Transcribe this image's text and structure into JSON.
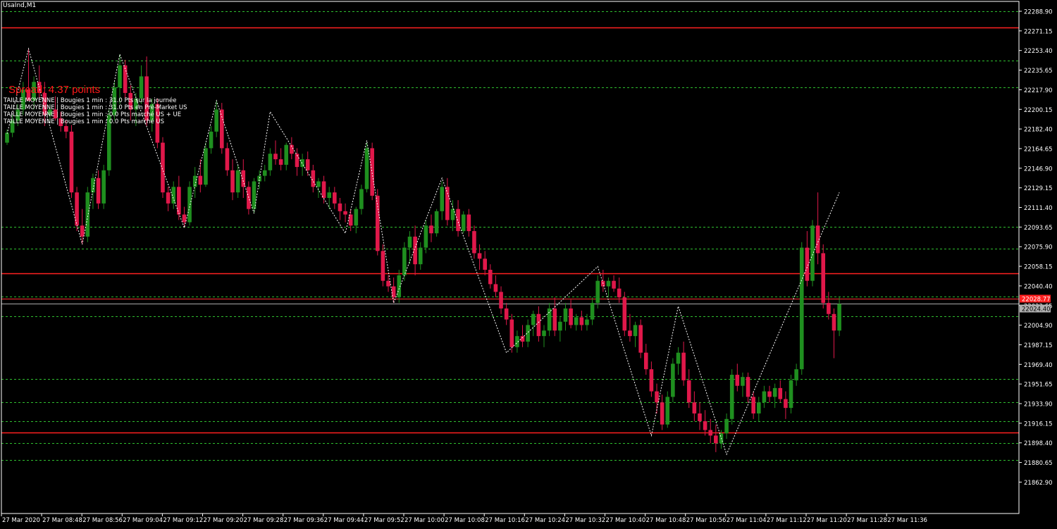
{
  "window": {
    "symbol_label": "UsaInd,M1"
  },
  "spread": {
    "label": "Spread: 4.37 points"
  },
  "info_lines": [
    "TAILLE MOYENNE | Bougies 1 min : 31.0 Pts sur la journée",
    "TAILLE MOYENNE | Bougies 1 min : 31.0 Pts en Pré-Market US",
    "TAILLE MOYENNE | Bougies 1 min : 0.0 Pts marché US + UE",
    "TAILLE MOYENNE | Bougies 1 min : 0.0 Pts marché US"
  ],
  "colors": {
    "background": "#000000",
    "bull": "#1f8f1f",
    "bear": "#e0184a",
    "grid_dashed": "#2fbf2f",
    "level_line": "#ff2020",
    "zigzag": "#ffffff",
    "axis_text": "#ffffff"
  },
  "price_axis": {
    "ticks": [
      "22288.90",
      "22271.15",
      "22253.40",
      "22235.65",
      "22217.90",
      "22200.15",
      "22182.40",
      "22164.65",
      "22146.90",
      "22129.15",
      "22111.40",
      "22093.65",
      "22075.90",
      "22058.15",
      "22040.40",
      "22022.65",
      "22004.90",
      "21987.15",
      "21969.40",
      "21951.65",
      "21933.90",
      "21916.15",
      "21898.40",
      "21880.65",
      "21862.90"
    ],
    "bid_label": "22024.40",
    "ask_label": "22028.77"
  },
  "time_axis": {
    "labels": [
      "27 Mar 2020",
      "27 Mar 08:48",
      "27 Mar 08:56",
      "27 Mar 09:04",
      "27 Mar 09:12",
      "27 Mar 09:20",
      "27 Mar 09:28",
      "27 Mar 09:36",
      "27 Mar 09:44",
      "27 Mar 09:52",
      "27 Mar 10:00",
      "27 Mar 10:08",
      "27 Mar 10:16",
      "27 Mar 10:24",
      "27 Mar 10:32",
      "27 Mar 10:40",
      "27 Mar 10:48",
      "27 Mar 10:56",
      "27 Mar 11:04",
      "27 Mar 11:12",
      "27 Mar 11:20",
      "27 Mar 11:28",
      "27 Mar 11:36"
    ]
  },
  "levels": {
    "solid_red": [
      22274,
      22052,
      21908
    ],
    "dashed_green": [
      22288.9,
      22244,
      22220,
      22094,
      22074,
      22031,
      22013,
      21956,
      21935,
      21918,
      21898,
      21883
    ]
  },
  "chart_data": {
    "type": "candlestick",
    "interval": "M1",
    "price_range": [
      21855,
      22297
    ],
    "candles": [
      {
        "o": 22170,
        "h": 22182,
        "l": 22168,
        "c": 22179
      },
      {
        "o": 22179,
        "h": 22195,
        "l": 22175,
        "c": 22190
      },
      {
        "o": 22190,
        "h": 22205,
        "l": 22185,
        "c": 22200
      },
      {
        "o": 22200,
        "h": 22225,
        "l": 22195,
        "c": 22218
      },
      {
        "o": 22218,
        "h": 22255,
        "l": 22212,
        "c": 22208
      },
      {
        "o": 22208,
        "h": 22230,
        "l": 22200,
        "c": 22225
      },
      {
        "o": 22225,
        "h": 22240,
        "l": 22210,
        "c": 22215
      },
      {
        "o": 22215,
        "h": 22225,
        "l": 22185,
        "c": 22195
      },
      {
        "o": 22195,
        "h": 22205,
        "l": 22188,
        "c": 22200
      },
      {
        "o": 22200,
        "h": 22212,
        "l": 22190,
        "c": 22192
      },
      {
        "o": 22192,
        "h": 22198,
        "l": 22180,
        "c": 22185
      },
      {
        "o": 22185,
        "h": 22190,
        "l": 22174,
        "c": 22180
      },
      {
        "o": 22180,
        "h": 22186,
        "l": 22120,
        "c": 22125
      },
      {
        "o": 22125,
        "h": 22130,
        "l": 22090,
        "c": 22095
      },
      {
        "o": 22095,
        "h": 22110,
        "l": 22078,
        "c": 22085
      },
      {
        "o": 22085,
        "h": 22130,
        "l": 22080,
        "c": 22125
      },
      {
        "o": 22125,
        "h": 22142,
        "l": 22110,
        "c": 22138
      },
      {
        "o": 22138,
        "h": 22145,
        "l": 22110,
        "c": 22115
      },
      {
        "o": 22115,
        "h": 22150,
        "l": 22110,
        "c": 22145
      },
      {
        "o": 22145,
        "h": 22200,
        "l": 22140,
        "c": 22195
      },
      {
        "o": 22195,
        "h": 22225,
        "l": 22190,
        "c": 22220
      },
      {
        "o": 22220,
        "h": 22250,
        "l": 22205,
        "c": 22240
      },
      {
        "o": 22240,
        "h": 22245,
        "l": 22210,
        "c": 22215
      },
      {
        "o": 22215,
        "h": 22222,
        "l": 22190,
        "c": 22200
      },
      {
        "o": 22200,
        "h": 22215,
        "l": 22185,
        "c": 22210
      },
      {
        "o": 22210,
        "h": 22240,
        "l": 22205,
        "c": 22230
      },
      {
        "o": 22230,
        "h": 22248,
        "l": 22185,
        "c": 22190
      },
      {
        "o": 22190,
        "h": 22210,
        "l": 22180,
        "c": 22205
      },
      {
        "o": 22205,
        "h": 22210,
        "l": 22165,
        "c": 22170
      },
      {
        "o": 22170,
        "h": 22175,
        "l": 22120,
        "c": 22125
      },
      {
        "o": 22125,
        "h": 22130,
        "l": 22108,
        "c": 22115
      },
      {
        "o": 22115,
        "h": 22135,
        "l": 22110,
        "c": 22130
      },
      {
        "o": 22130,
        "h": 22140,
        "l": 22100,
        "c": 22105
      },
      {
        "o": 22105,
        "h": 22112,
        "l": 22093,
        "c": 22098
      },
      {
        "o": 22098,
        "h": 22135,
        "l": 22095,
        "c": 22130
      },
      {
        "o": 22130,
        "h": 22148,
        "l": 22120,
        "c": 22140
      },
      {
        "o": 22140,
        "h": 22155,
        "l": 22125,
        "c": 22132
      },
      {
        "o": 22132,
        "h": 22170,
        "l": 22130,
        "c": 22165
      },
      {
        "o": 22165,
        "h": 22185,
        "l": 22160,
        "c": 22180
      },
      {
        "o": 22180,
        "h": 22208,
        "l": 22175,
        "c": 22200
      },
      {
        "o": 22200,
        "h": 22206,
        "l": 22160,
        "c": 22165
      },
      {
        "o": 22165,
        "h": 22170,
        "l": 22140,
        "c": 22145
      },
      {
        "o": 22145,
        "h": 22155,
        "l": 22118,
        "c": 22125
      },
      {
        "o": 22125,
        "h": 22150,
        "l": 22120,
        "c": 22145
      },
      {
        "o": 22145,
        "h": 22155,
        "l": 22120,
        "c": 22130
      },
      {
        "o": 22130,
        "h": 22135,
        "l": 22105,
        "c": 22110
      },
      {
        "o": 22110,
        "h": 22138,
        "l": 22106,
        "c": 22135
      },
      {
        "o": 22135,
        "h": 22145,
        "l": 22128,
        "c": 22140
      },
      {
        "o": 22140,
        "h": 22150,
        "l": 22135,
        "c": 22145
      },
      {
        "o": 22145,
        "h": 22165,
        "l": 22140,
        "c": 22160
      },
      {
        "o": 22160,
        "h": 22172,
        "l": 22150,
        "c": 22155
      },
      {
        "o": 22155,
        "h": 22165,
        "l": 22145,
        "c": 22150
      },
      {
        "o": 22150,
        "h": 22170,
        "l": 22145,
        "c": 22168
      },
      {
        "o": 22168,
        "h": 22175,
        "l": 22155,
        "c": 22160
      },
      {
        "o": 22160,
        "h": 22165,
        "l": 22140,
        "c": 22148
      },
      {
        "o": 22148,
        "h": 22160,
        "l": 22140,
        "c": 22155
      },
      {
        "o": 22155,
        "h": 22162,
        "l": 22140,
        "c": 22145
      },
      {
        "o": 22145,
        "h": 22150,
        "l": 22125,
        "c": 22130
      },
      {
        "o": 22130,
        "h": 22138,
        "l": 22120,
        "c": 22135
      },
      {
        "o": 22135,
        "h": 22140,
        "l": 22115,
        "c": 22120
      },
      {
        "o": 22120,
        "h": 22130,
        "l": 22110,
        "c": 22125
      },
      {
        "o": 22125,
        "h": 22130,
        "l": 22110,
        "c": 22115
      },
      {
        "o": 22115,
        "h": 22120,
        "l": 22100,
        "c": 22108
      },
      {
        "o": 22108,
        "h": 22115,
        "l": 22098,
        "c": 22105
      },
      {
        "o": 22105,
        "h": 22110,
        "l": 22090,
        "c": 22095
      },
      {
        "o": 22095,
        "h": 22112,
        "l": 22088,
        "c": 22110
      },
      {
        "o": 22110,
        "h": 22132,
        "l": 22105,
        "c": 22128
      },
      {
        "o": 22128,
        "h": 22170,
        "l": 22125,
        "c": 22165
      },
      {
        "o": 22165,
        "h": 22170,
        "l": 22118,
        "c": 22122
      },
      {
        "o": 22122,
        "h": 22128,
        "l": 22068,
        "c": 22072
      },
      {
        "o": 22072,
        "h": 22078,
        "l": 22040,
        "c": 22045
      },
      {
        "o": 22045,
        "h": 22050,
        "l": 22035,
        "c": 22040
      },
      {
        "o": 22040,
        "h": 22048,
        "l": 22025,
        "c": 22030
      },
      {
        "o": 22030,
        "h": 22055,
        "l": 22025,
        "c": 22050
      },
      {
        "o": 22050,
        "h": 22080,
        "l": 22045,
        "c": 22075
      },
      {
        "o": 22075,
        "h": 22090,
        "l": 22060,
        "c": 22085
      },
      {
        "o": 22085,
        "h": 22095,
        "l": 22050,
        "c": 22060
      },
      {
        "o": 22060,
        "h": 22080,
        "l": 22055,
        "c": 22075
      },
      {
        "o": 22075,
        "h": 22100,
        "l": 22070,
        "c": 22095
      },
      {
        "o": 22095,
        "h": 22105,
        "l": 22080,
        "c": 22088
      },
      {
        "o": 22088,
        "h": 22110,
        "l": 22085,
        "c": 22108
      },
      {
        "o": 22108,
        "h": 22135,
        "l": 22100,
        "c": 22130
      },
      {
        "o": 22130,
        "h": 22138,
        "l": 22095,
        "c": 22100
      },
      {
        "o": 22100,
        "h": 22118,
        "l": 22090,
        "c": 22110
      },
      {
        "o": 22110,
        "h": 22118,
        "l": 22085,
        "c": 22090
      },
      {
        "o": 22090,
        "h": 22108,
        "l": 22088,
        "c": 22105
      },
      {
        "o": 22105,
        "h": 22110,
        "l": 22085,
        "c": 22090
      },
      {
        "o": 22090,
        "h": 22095,
        "l": 22065,
        "c": 22070
      },
      {
        "o": 22070,
        "h": 22078,
        "l": 22055,
        "c": 22065
      },
      {
        "o": 22065,
        "h": 22072,
        "l": 22050,
        "c": 22055
      },
      {
        "o": 22055,
        "h": 22060,
        "l": 22038,
        "c": 22042
      },
      {
        "o": 22042,
        "h": 22050,
        "l": 22030,
        "c": 22035
      },
      {
        "o": 22035,
        "h": 22040,
        "l": 22015,
        "c": 22020
      },
      {
        "o": 22020,
        "h": 22025,
        "l": 22005,
        "c": 22010
      },
      {
        "o": 22010,
        "h": 22015,
        "l": 21980,
        "c": 21985
      },
      {
        "o": 21985,
        "h": 22000,
        "l": 21980,
        "c": 21995
      },
      {
        "o": 21995,
        "h": 22005,
        "l": 21985,
        "c": 21990
      },
      {
        "o": 21990,
        "h": 22010,
        "l": 21985,
        "c": 22005
      },
      {
        "o": 22005,
        "h": 22018,
        "l": 21995,
        "c": 22015
      },
      {
        "o": 22015,
        "h": 22022,
        "l": 21990,
        "c": 21995
      },
      {
        "o": 21995,
        "h": 22005,
        "l": 21985,
        "c": 22000
      },
      {
        "o": 22000,
        "h": 22025,
        "l": 21995,
        "c": 22020
      },
      {
        "o": 22020,
        "h": 22030,
        "l": 21995,
        "c": 22000
      },
      {
        "o": 22000,
        "h": 22012,
        "l": 21990,
        "c": 22008
      },
      {
        "o": 22008,
        "h": 22025,
        "l": 22000,
        "c": 22020
      },
      {
        "o": 22020,
        "h": 22028,
        "l": 22002,
        "c": 22005
      },
      {
        "o": 22005,
        "h": 22015,
        "l": 22000,
        "c": 22012
      },
      {
        "o": 22012,
        "h": 22018,
        "l": 22000,
        "c": 22005
      },
      {
        "o": 22005,
        "h": 22015,
        "l": 22000,
        "c": 22010
      },
      {
        "o": 22010,
        "h": 22030,
        "l": 22005,
        "c": 22025
      },
      {
        "o": 22025,
        "h": 22050,
        "l": 22020,
        "c": 22045
      },
      {
        "o": 22045,
        "h": 22055,
        "l": 22035,
        "c": 22040
      },
      {
        "o": 22040,
        "h": 22048,
        "l": 22030,
        "c": 22045
      },
      {
        "o": 22045,
        "h": 22050,
        "l": 22035,
        "c": 22038
      },
      {
        "o": 22038,
        "h": 22048,
        "l": 22025,
        "c": 22030
      },
      {
        "o": 22030,
        "h": 22035,
        "l": 21995,
        "c": 22000
      },
      {
        "o": 22000,
        "h": 22015,
        "l": 21990,
        "c": 21995
      },
      {
        "o": 21995,
        "h": 22008,
        "l": 21985,
        "c": 22005
      },
      {
        "o": 22005,
        "h": 22010,
        "l": 21975,
        "c": 21980
      },
      {
        "o": 21980,
        "h": 21988,
        "l": 21960,
        "c": 21965
      },
      {
        "o": 21965,
        "h": 21972,
        "l": 21940,
        "c": 21945
      },
      {
        "o": 21945,
        "h": 21952,
        "l": 21925,
        "c": 21935
      },
      {
        "o": 21935,
        "h": 21942,
        "l": 21910,
        "c": 21915
      },
      {
        "o": 21915,
        "h": 21945,
        "l": 21912,
        "c": 21940
      },
      {
        "o": 21940,
        "h": 21975,
        "l": 21935,
        "c": 21970
      },
      {
        "o": 21970,
        "h": 21985,
        "l": 21960,
        "c": 21980
      },
      {
        "o": 21980,
        "h": 21990,
        "l": 21950,
        "c": 21955
      },
      {
        "o": 21955,
        "h": 21965,
        "l": 21930,
        "c": 21935
      },
      {
        "o": 21935,
        "h": 21945,
        "l": 21918,
        "c": 21925
      },
      {
        "o": 21925,
        "h": 21935,
        "l": 21910,
        "c": 21918
      },
      {
        "o": 21918,
        "h": 21928,
        "l": 21905,
        "c": 21910
      },
      {
        "o": 21910,
        "h": 21920,
        "l": 21898,
        "c": 21905
      },
      {
        "o": 21905,
        "h": 21915,
        "l": 21890,
        "c": 21898
      },
      {
        "o": 21898,
        "h": 21910,
        "l": 21893,
        "c": 21907
      },
      {
        "o": 21907,
        "h": 21925,
        "l": 21902,
        "c": 21920
      },
      {
        "o": 21920,
        "h": 21965,
        "l": 21915,
        "c": 21960
      },
      {
        "o": 21960,
        "h": 21970,
        "l": 21945,
        "c": 21950
      },
      {
        "o": 21950,
        "h": 21962,
        "l": 21940,
        "c": 21958
      },
      {
        "o": 21958,
        "h": 21962,
        "l": 21935,
        "c": 21940
      },
      {
        "o": 21940,
        "h": 21945,
        "l": 21920,
        "c": 21925
      },
      {
        "o": 21925,
        "h": 21940,
        "l": 21918,
        "c": 21935
      },
      {
        "o": 21935,
        "h": 21950,
        "l": 21930,
        "c": 21945
      },
      {
        "o": 21945,
        "h": 21950,
        "l": 21935,
        "c": 21940
      },
      {
        "o": 21940,
        "h": 21952,
        "l": 21930,
        "c": 21948
      },
      {
        "o": 21948,
        "h": 21955,
        "l": 21935,
        "c": 21938
      },
      {
        "o": 21938,
        "h": 21945,
        "l": 21920,
        "c": 21930
      },
      {
        "o": 21930,
        "h": 21960,
        "l": 21925,
        "c": 21955
      },
      {
        "o": 21955,
        "h": 21970,
        "l": 21950,
        "c": 21965
      },
      {
        "o": 21965,
        "h": 22080,
        "l": 21960,
        "c": 22075
      },
      {
        "o": 22075,
        "h": 22090,
        "l": 22040,
        "c": 22045
      },
      {
        "o": 22045,
        "h": 22100,
        "l": 22040,
        "c": 22095
      },
      {
        "o": 22095,
        "h": 22125,
        "l": 22060,
        "c": 22070
      },
      {
        "o": 22070,
        "h": 22078,
        "l": 22020,
        "c": 22025
      },
      {
        "o": 22025,
        "h": 22035,
        "l": 22010,
        "c": 22015
      },
      {
        "o": 22015,
        "h": 22020,
        "l": 21975,
        "c": 22000
      },
      {
        "o": 22000,
        "h": 22030,
        "l": 21995,
        "c": 22024
      }
    ],
    "zigzag": [
      {
        "i": 0,
        "p": 22178
      },
      {
        "i": 4,
        "p": 22255
      },
      {
        "i": 14,
        "p": 22078
      },
      {
        "i": 21,
        "p": 22250
      },
      {
        "i": 33,
        "p": 22093
      },
      {
        "i": 39,
        "p": 22208
      },
      {
        "i": 46,
        "p": 22106
      },
      {
        "i": 49,
        "p": 22198
      },
      {
        "i": 63,
        "p": 22088
      },
      {
        "i": 67,
        "p": 22172
      },
      {
        "i": 72,
        "p": 22025
      },
      {
        "i": 81,
        "p": 22138
      },
      {
        "i": 93,
        "p": 21980
      },
      {
        "i": 110,
        "p": 22058
      },
      {
        "i": 120,
        "p": 21905
      },
      {
        "i": 125,
        "p": 22022
      },
      {
        "i": 134,
        "p": 21888
      },
      {
        "i": 155,
        "p": 22125
      }
    ]
  }
}
